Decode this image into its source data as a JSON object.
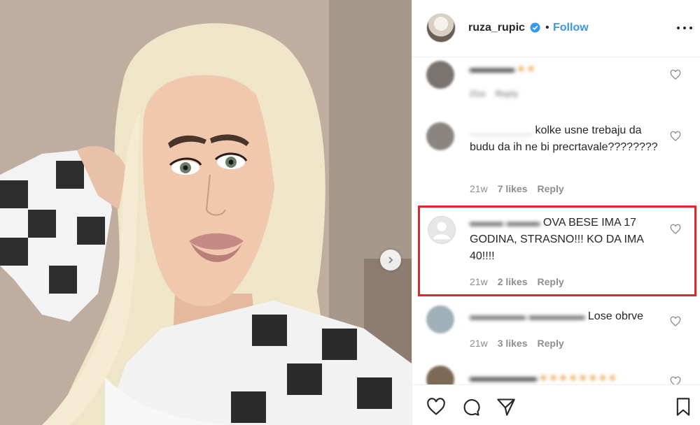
{
  "post": {
    "username": "ruza_rupic",
    "follow_label": "Follow",
    "dot": "•"
  },
  "comments": [
    {
      "name": "",
      "text": "",
      "time": "21w",
      "likes": "",
      "reply": "Reply"
    },
    {
      "name": "__________",
      "text": "kolke usne trebaju da budu da ih ne bi precrtavale????????",
      "time": "21w",
      "likes": "7 likes",
      "reply": "Reply"
    },
    {
      "name": "",
      "text": "OVA BESE IMA 17 GODINA, STRASNO!!! KO DA IMA 40!!!!",
      "time": "21w",
      "likes": "2 likes",
      "reply": "Reply"
    },
    {
      "name": "",
      "text": "Lose obrve",
      "time": "21w",
      "likes": "3 likes",
      "reply": "Reply"
    }
  ],
  "icons": {
    "verified": "verified-badge-icon",
    "more": "more-options-icon",
    "like": "heart-icon",
    "comment": "comment-icon",
    "share": "share-icon",
    "save": "bookmark-icon",
    "next": "chevron-right-icon"
  },
  "colors": {
    "accent": "#3897f0",
    "highlight": "#e3262b",
    "meta": "#8e8e8e"
  }
}
